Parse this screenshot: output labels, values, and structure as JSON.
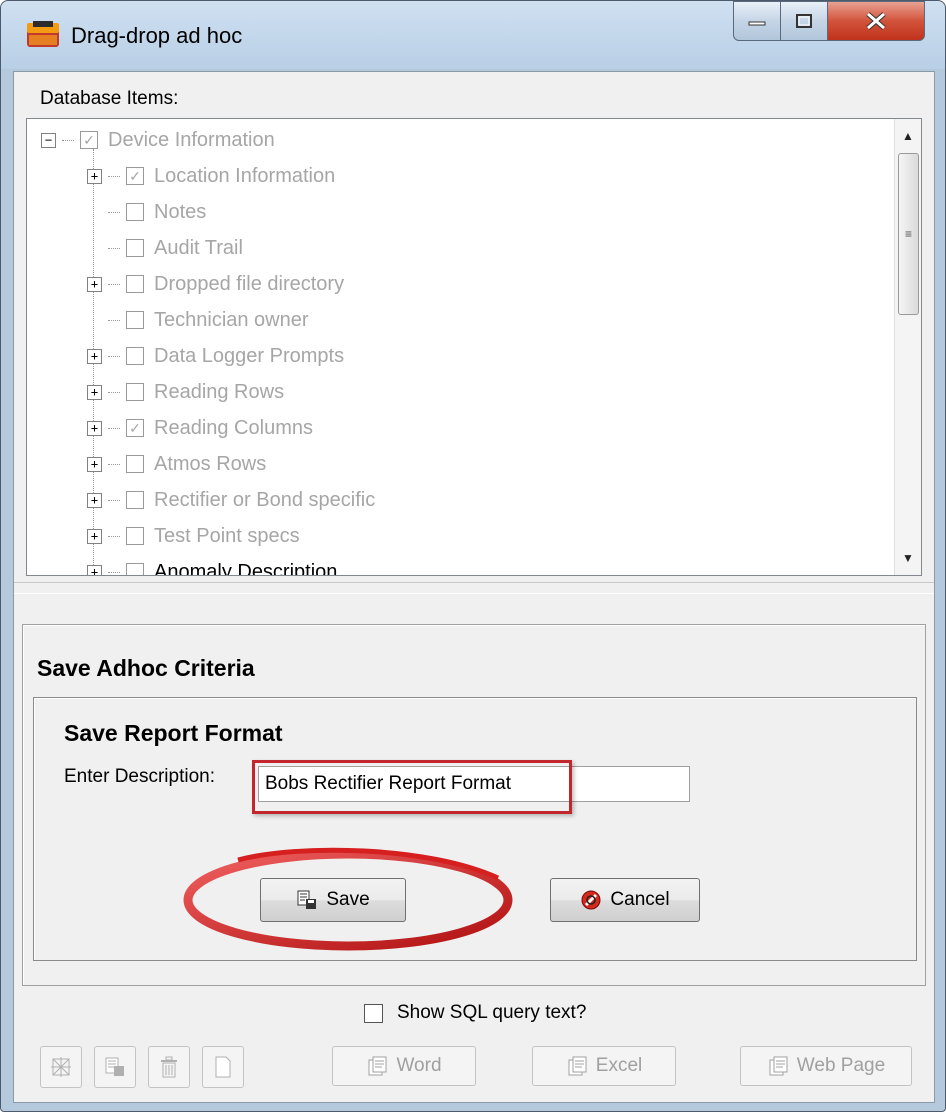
{
  "window": {
    "title": "Drag-drop ad hoc",
    "icon": "app-icon"
  },
  "db_items": {
    "label": "Database Items:",
    "tree": [
      {
        "label": "Device Information",
        "checked": true,
        "expander": "−",
        "level": 0
      },
      {
        "label": "Location Information",
        "checked": true,
        "expander": "+",
        "level": 1
      },
      {
        "label": "Notes",
        "checked": false,
        "expander": "",
        "level": 1
      },
      {
        "label": "Audit Trail",
        "checked": false,
        "expander": "",
        "level": 1
      },
      {
        "label": "Dropped file directory",
        "checked": false,
        "expander": "+",
        "level": 1
      },
      {
        "label": "Technician owner",
        "checked": false,
        "expander": "",
        "level": 1
      },
      {
        "label": "Data Logger Prompts",
        "checked": false,
        "expander": "+",
        "level": 1
      },
      {
        "label": "Reading Rows",
        "checked": false,
        "expander": "+",
        "level": 1
      },
      {
        "label": "Reading Columns",
        "checked": true,
        "expander": "+",
        "level": 1
      },
      {
        "label": "Atmos Rows",
        "checked": false,
        "expander": "+",
        "level": 1
      },
      {
        "label": "Rectifier or Bond specific",
        "checked": false,
        "expander": "+",
        "level": 1
      },
      {
        "label": "Test Point specs",
        "checked": false,
        "expander": "+",
        "level": 1
      },
      {
        "label": "Anomaly Description",
        "checked": false,
        "expander": "+",
        "level": 1
      }
    ]
  },
  "save_panel": {
    "title": "Save Adhoc Criteria",
    "group_title": "Save Report Format",
    "desc_label": "Enter Description:",
    "desc_value": "Bobs Rectifier Report Format",
    "save_label": "Save",
    "cancel_label": "Cancel"
  },
  "footer": {
    "sql_label": "Show SQL query text?",
    "sql_checked": false,
    "word_label": "Word",
    "excel_label": "Excel",
    "web_label": "Web Page"
  },
  "colors": {
    "annotation_red": "#c1272d",
    "disabled_text": "#a6a6a6"
  }
}
